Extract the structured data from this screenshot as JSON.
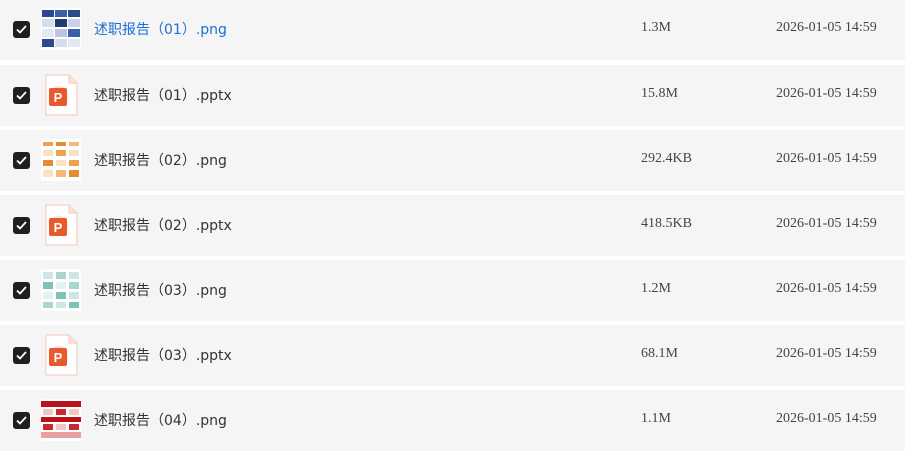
{
  "files": [
    {
      "name": "述职报告（01）.png",
      "size": "1.3M",
      "date": "2026-01-05 14:59",
      "type": "png",
      "thumb": "blue-slides-thumbnail",
      "link": true
    },
    {
      "name": "述职报告（01）.pptx",
      "size": "15.8M",
      "date": "2026-01-05 14:59",
      "type": "pptx",
      "thumb": "powerpoint-icon",
      "link": false
    },
    {
      "name": "述职报告（02）.png",
      "size": "292.4KB",
      "date": "2026-01-05 14:59",
      "type": "png",
      "thumb": "orange-slides-thumbnail",
      "link": false
    },
    {
      "name": "述职报告（02）.pptx",
      "size": "418.5KB",
      "date": "2026-01-05 14:59",
      "type": "pptx",
      "thumb": "powerpoint-icon",
      "link": false
    },
    {
      "name": "述职报告（03）.png",
      "size": "1.2M",
      "date": "2026-01-05 14:59",
      "type": "png",
      "thumb": "teal-slides-thumbnail",
      "link": false
    },
    {
      "name": "述职报告（03）.pptx",
      "size": "68.1M",
      "date": "2026-01-05 14:59",
      "type": "pptx",
      "thumb": "powerpoint-icon",
      "link": false
    },
    {
      "name": "述职报告（04）.png",
      "size": "1.1M",
      "date": "2026-01-05 14:59",
      "type": "png",
      "thumb": "red-slides-thumbnail",
      "link": false
    }
  ],
  "checked": [
    true,
    true,
    true,
    true,
    true,
    true,
    true
  ],
  "colors": {
    "row_bg": "#f5f5f5",
    "link": "#1a6fd6",
    "text": "#333333",
    "checkbox": "#1f1f1f",
    "ppt_orange": "#e8592c"
  }
}
